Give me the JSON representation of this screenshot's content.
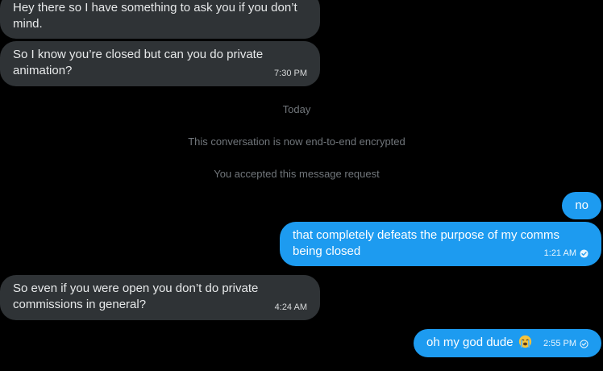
{
  "messages": {
    "m1": {
      "text": "Hey there so I have something to ask you if you don’t mind."
    },
    "m2": {
      "text": "So I know you’re closed but can you do private animation?",
      "time": "7:30 PM"
    },
    "m3": {
      "text": "no"
    },
    "m4": {
      "text": "that completely defeats the purpose of my comms being closed",
      "time": "1:21 AM"
    },
    "m5": {
      "text": "So even if you were open you don’t do private commissions in general?",
      "time": "4:24 AM"
    },
    "m6": {
      "text": "oh my god dude",
      "emoji": "loudly-crying-face-icon",
      "time": "2:55 PM"
    }
  },
  "system": {
    "date_divider": "Today",
    "encrypted_notice": "This conversation is now end-to-end encrypted",
    "request_notice": "You accepted this message request"
  },
  "colors": {
    "background": "#000000",
    "incoming_bubble": "#2f3336",
    "outgoing_bubble": "#1d9bf0",
    "system_text": "#71767b"
  }
}
